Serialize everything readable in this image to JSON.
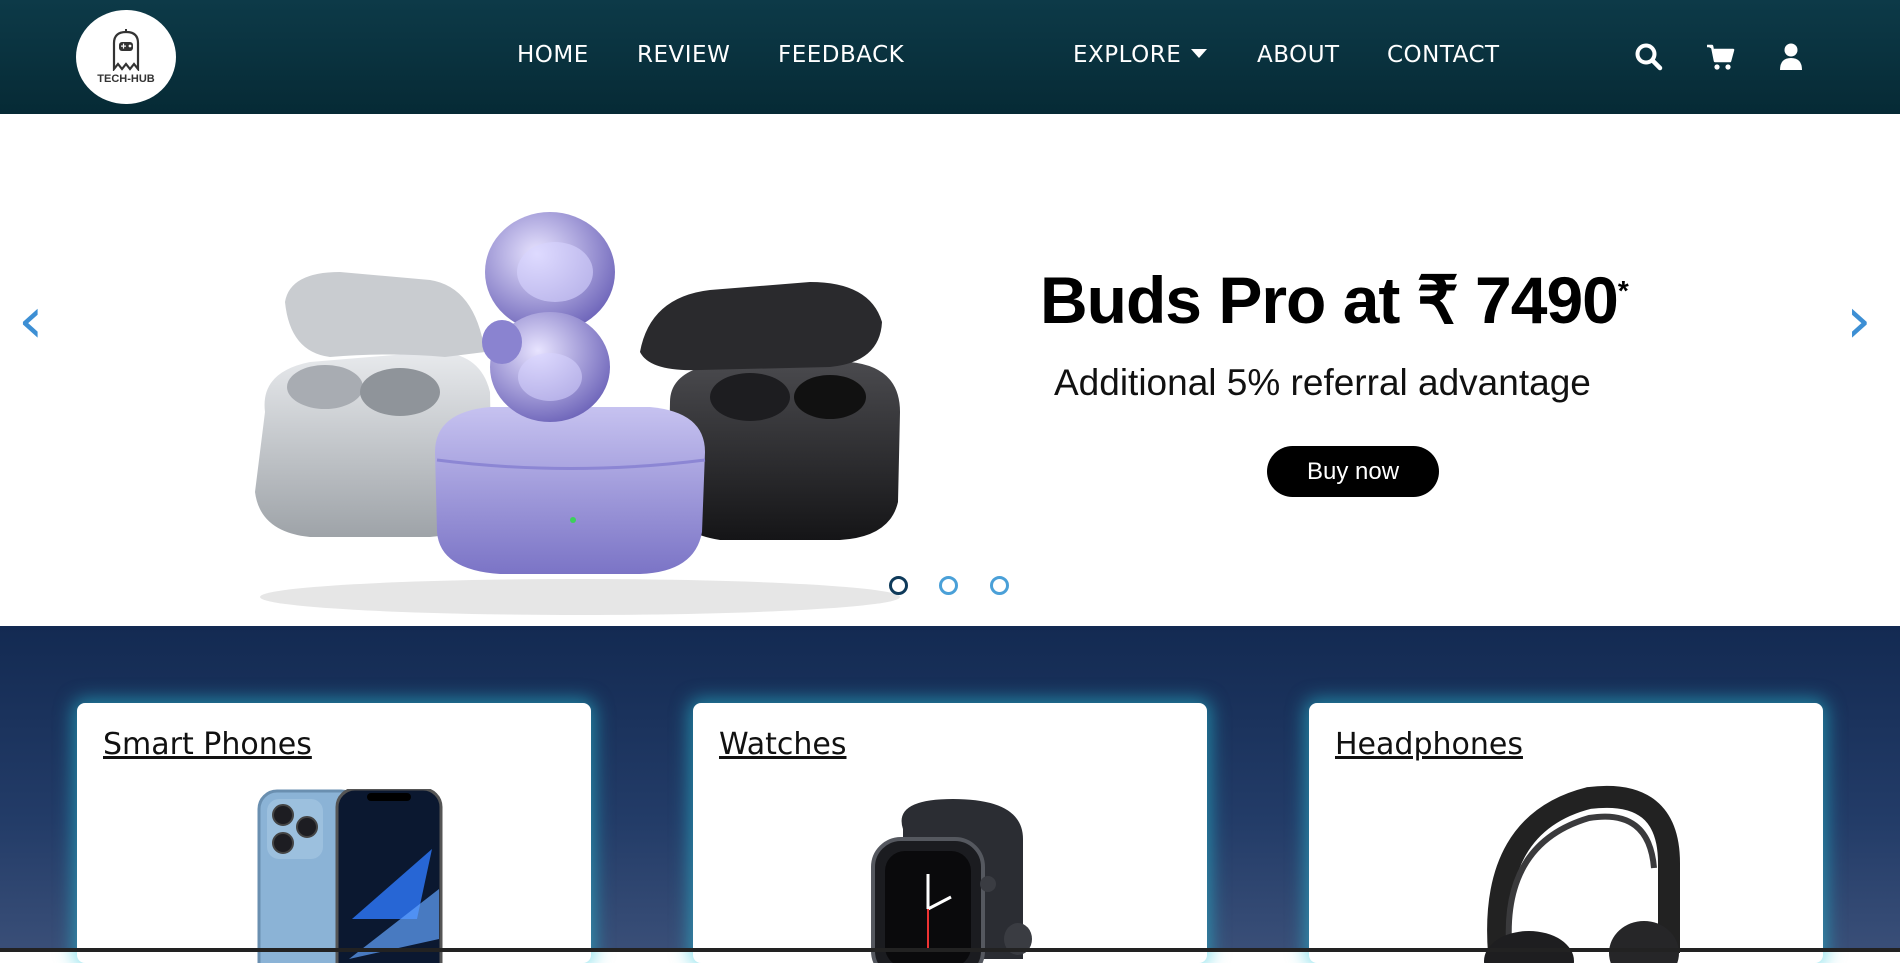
{
  "brand": {
    "logo_text": "TECH-HUB"
  },
  "nav": {
    "home": "HOME",
    "review": "REVIEW",
    "feedback": "FEEDBACK",
    "explore": "EXPLORE",
    "about": "ABOUT",
    "contact": "CONTACT",
    "icons": [
      "search-icon",
      "cart-icon",
      "user-icon"
    ]
  },
  "hero": {
    "title": "Buds Pro at ₹ 7490",
    "title_sup": "*",
    "subtitle": "Additional 5% referral advantage",
    "button": "Buy now",
    "prev_arrow": "‹",
    "next_arrow": "›",
    "slides": 3,
    "active_slide": 1
  },
  "categories": [
    {
      "label": "Smart Phones"
    },
    {
      "label": "Watches"
    },
    {
      "label": "Headphones"
    }
  ],
  "colors": {
    "nav_bg": "#0d3a48",
    "section_bg": "#132a52",
    "accent_arrow": "#3d8fd4",
    "card_glow": "#28c8dc"
  }
}
